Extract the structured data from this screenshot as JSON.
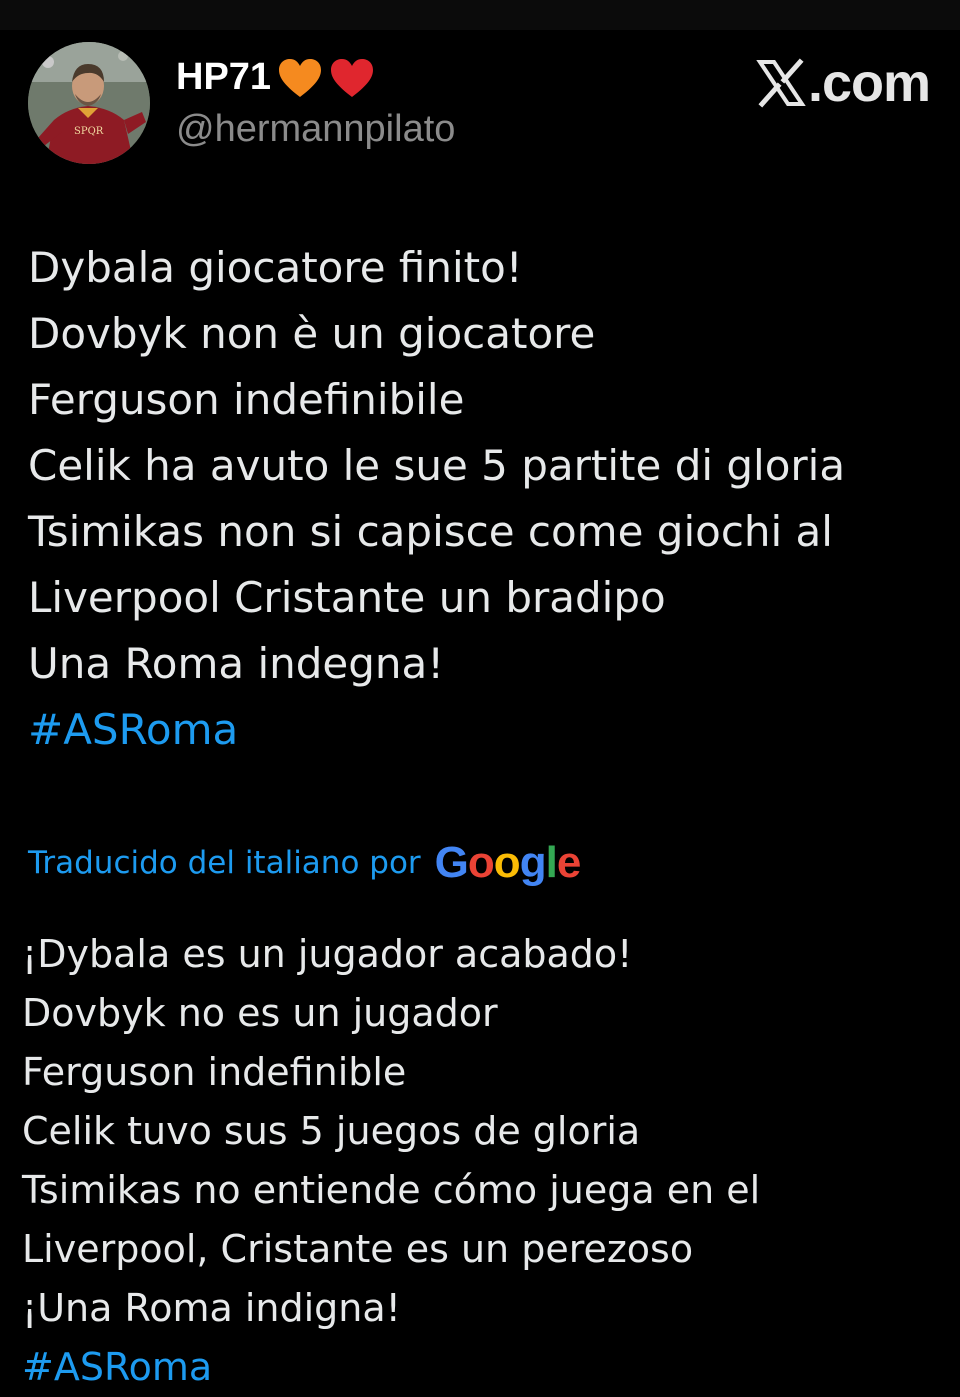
{
  "author": {
    "display_name": "HP71",
    "handle": "@hermannpilato",
    "emojis": [
      "orange-heart-icon",
      "red-heart-icon"
    ],
    "avatar_badge": "SPQR"
  },
  "brand": {
    "x_glyph": "X",
    "label": ".com"
  },
  "tweet": {
    "lines": [
      "Dybala giocatore finito!",
      "Dovbyk non è un giocatore",
      "Ferguson indefinibile",
      "Celik ha avuto le sue 5 partite di gloria",
      "Tsimikas non si capisce come giochi al",
      "Liverpool Cristante un bradipo",
      "Una Roma indegna!"
    ],
    "hashtag": "#ASRoma"
  },
  "translation": {
    "label": "Traducido del italiano por",
    "provider": "Google",
    "lines": [
      "¡Dybala es un jugador acabado!",
      "Dovbyk no es un jugador",
      "Ferguson indefinible",
      "Celik tuvo sus 5 juegos de gloria",
      "Tsimikas no entiende cómo juega en el",
      "Liverpool, Cristante es un perezoso",
      "¡Una Roma indigna!"
    ],
    "hashtag": "#ASRoma"
  },
  "colors": {
    "background": "#000000",
    "text": "#e7e9ea",
    "muted": "#8b8b8b",
    "link": "#1d9bf0",
    "google_blue": "#4285F4",
    "google_red": "#EA4335",
    "google_yellow": "#FBBC05",
    "google_green": "#34A853"
  }
}
